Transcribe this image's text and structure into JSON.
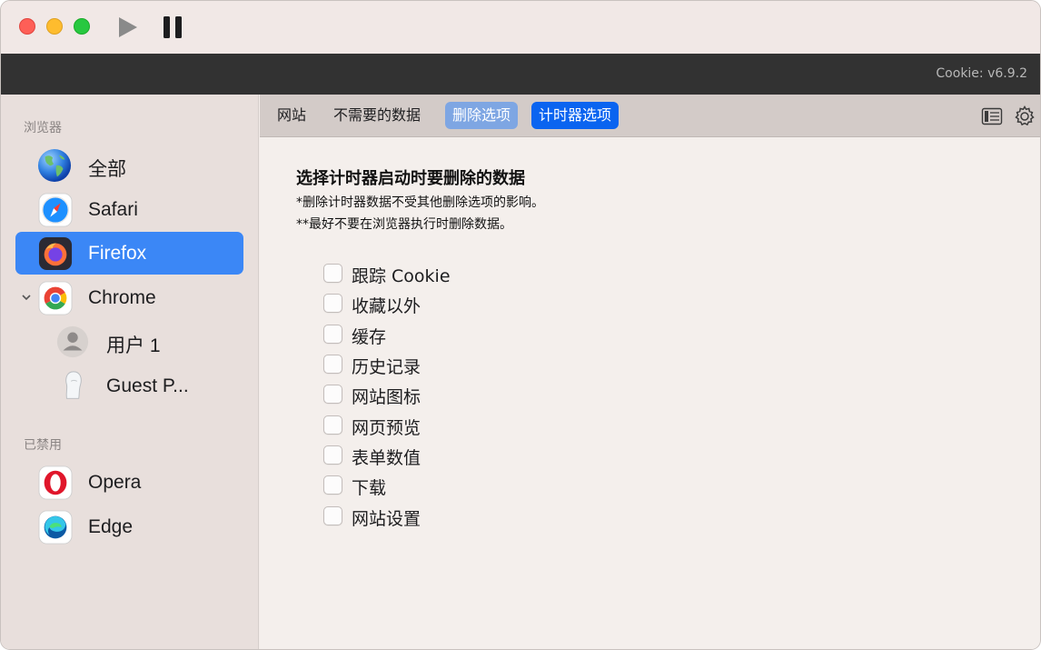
{
  "app": {
    "version": "Cookie: v6.9.2"
  },
  "window_controls": {
    "close": "close",
    "minimize": "minimize",
    "zoom": "zoom"
  },
  "toolbar": {
    "play_icon": "play-icon",
    "pause_icon": "pause-icon"
  },
  "sidebar": {
    "browsers_title": "浏览器",
    "disabled_title": "已禁用",
    "items": [
      {
        "label": "全部",
        "icon": "globe-icon"
      },
      {
        "label": "Safari",
        "icon": "safari-icon"
      },
      {
        "label": "Firefox",
        "icon": "firefox-icon",
        "selected": true
      },
      {
        "label": "Chrome",
        "icon": "chrome-icon",
        "expanded": true
      },
      {
        "label": "用户 1",
        "icon": "user-avatar-icon"
      },
      {
        "label": "Guest P...",
        "icon": "guest-profile-icon"
      }
    ],
    "disabled_items": [
      {
        "label": "Opera",
        "icon": "opera-icon"
      },
      {
        "label": "Edge",
        "icon": "edge-icon"
      }
    ]
  },
  "tabs": [
    {
      "label": "网站"
    },
    {
      "label": "不需要的数据"
    },
    {
      "label": "删除选项"
    },
    {
      "label": "计时器选项",
      "active": true
    }
  ],
  "main": {
    "heading": "选择计时器启动时要删除的数据",
    "note1": "*删除计时器数据不受其他删除选项的影响。",
    "note2": "**最好不要在浏览器执行时删除数据。",
    "options": [
      {
        "label": "跟踪 Cookie",
        "checked": false
      },
      {
        "label": "收藏以外",
        "checked": false
      },
      {
        "label": "缓存",
        "checked": false
      },
      {
        "label": "历史记录",
        "checked": false
      },
      {
        "label": "网站图标",
        "checked": false
      },
      {
        "label": "网页预览",
        "checked": false
      },
      {
        "label": "表单数值",
        "checked": false
      },
      {
        "label": "下载",
        "checked": false
      },
      {
        "label": "网站设置",
        "checked": false
      }
    ]
  },
  "colors": {
    "accent": "#0a64f0",
    "selection": "#3b87f6",
    "toolbar_dark": "#323232"
  }
}
